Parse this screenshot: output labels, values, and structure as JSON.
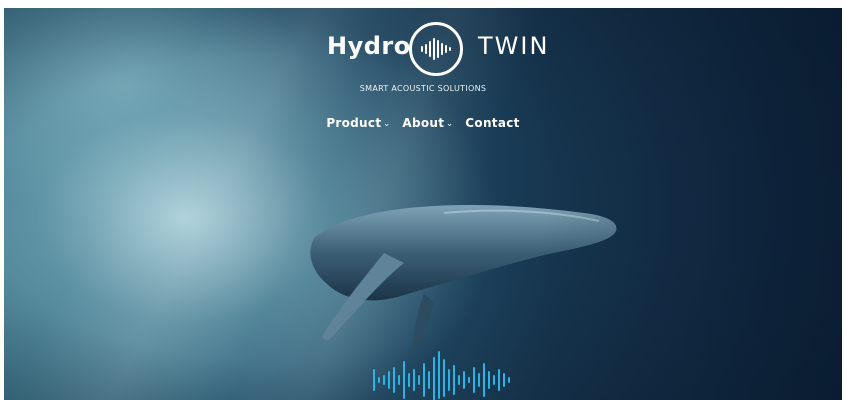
{
  "brand": {
    "left": "Hydro",
    "right": "TWIN",
    "tagline": "SMART ACOUSTIC SOLUTIONS",
    "logo_icon": "soundwave-circle-icon"
  },
  "nav": {
    "items": [
      {
        "label": "Product",
        "has_dropdown": true
      },
      {
        "label": "About",
        "has_dropdown": true
      },
      {
        "label": "Contact",
        "has_dropdown": false
      }
    ]
  },
  "hero": {
    "image": "humpback-whale-underwater-photo",
    "overlay_icon": "soundwave-icon"
  },
  "colors": {
    "accent": "#2bb3e6",
    "text": "#ffffff",
    "deep": "#0f2540",
    "light": "#bfe2ea"
  }
}
